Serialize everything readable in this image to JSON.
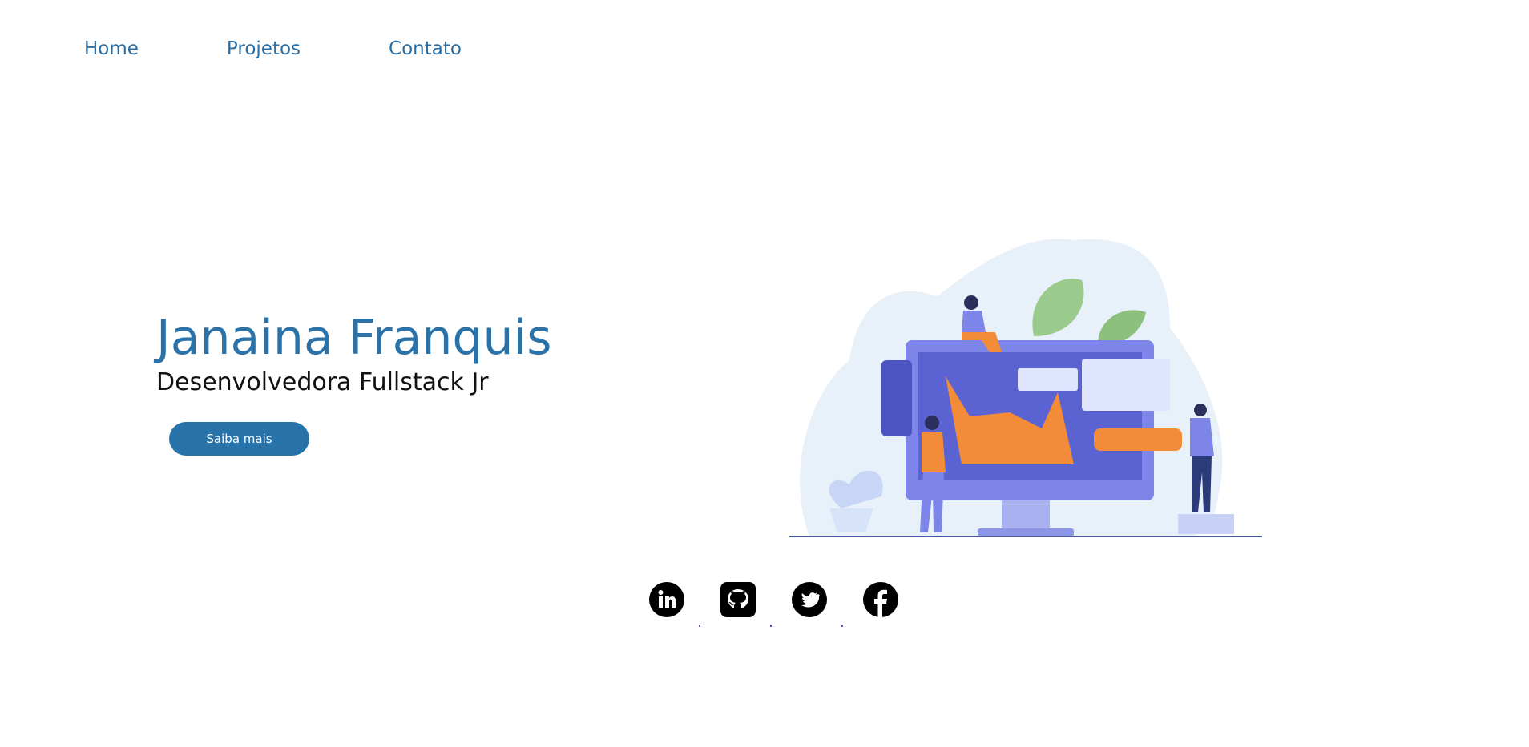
{
  "nav": {
    "items": [
      {
        "label": "Home"
      },
      {
        "label": "Projetos"
      },
      {
        "label": "Contato"
      }
    ]
  },
  "hero": {
    "name": "Janaina Franquis",
    "role": "Desenvolvedora Fullstack Jr",
    "cta_label": "Saiba mais"
  },
  "social": {
    "icons": [
      "linkedin-icon",
      "github-icon",
      "twitter-icon",
      "facebook-icon"
    ]
  },
  "colors": {
    "accent": "#2a72a8",
    "button": "#2873aa",
    "text": "#111111",
    "illustration_primary": "#5b63d3",
    "illustration_orange": "#f28c38",
    "illustration_bg": "#e8f0f9",
    "leaf_green": "#9bcb8c"
  }
}
